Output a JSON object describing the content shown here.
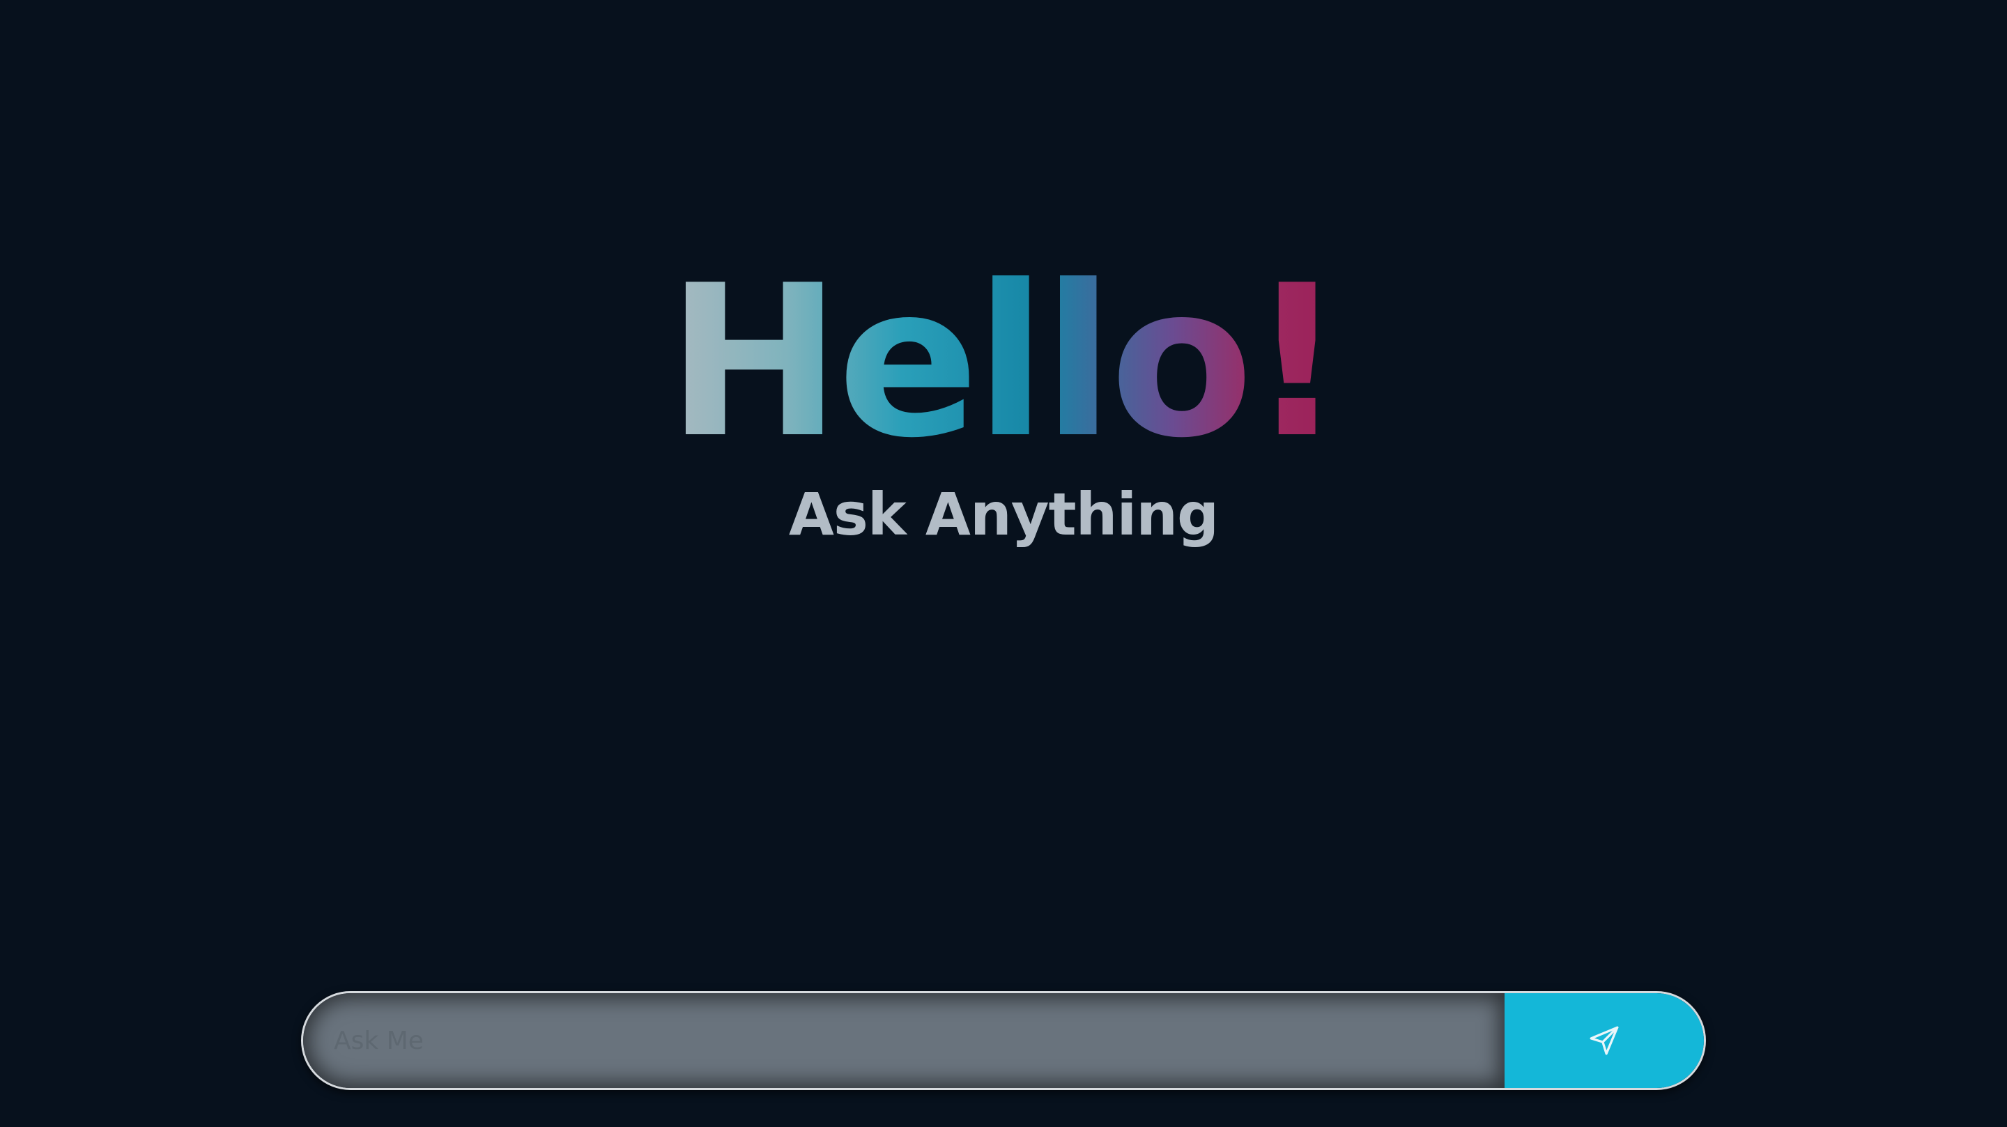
{
  "hero": {
    "title": "Hello!",
    "subtitle": "Ask Anything"
  },
  "chat": {
    "placeholder": "Ask Me",
    "send_icon": "send-icon"
  },
  "colors": {
    "background": "#07111d",
    "accent": "#14b7d8",
    "subtitle": "#b2bcc6",
    "input_bg": "#69737d"
  }
}
